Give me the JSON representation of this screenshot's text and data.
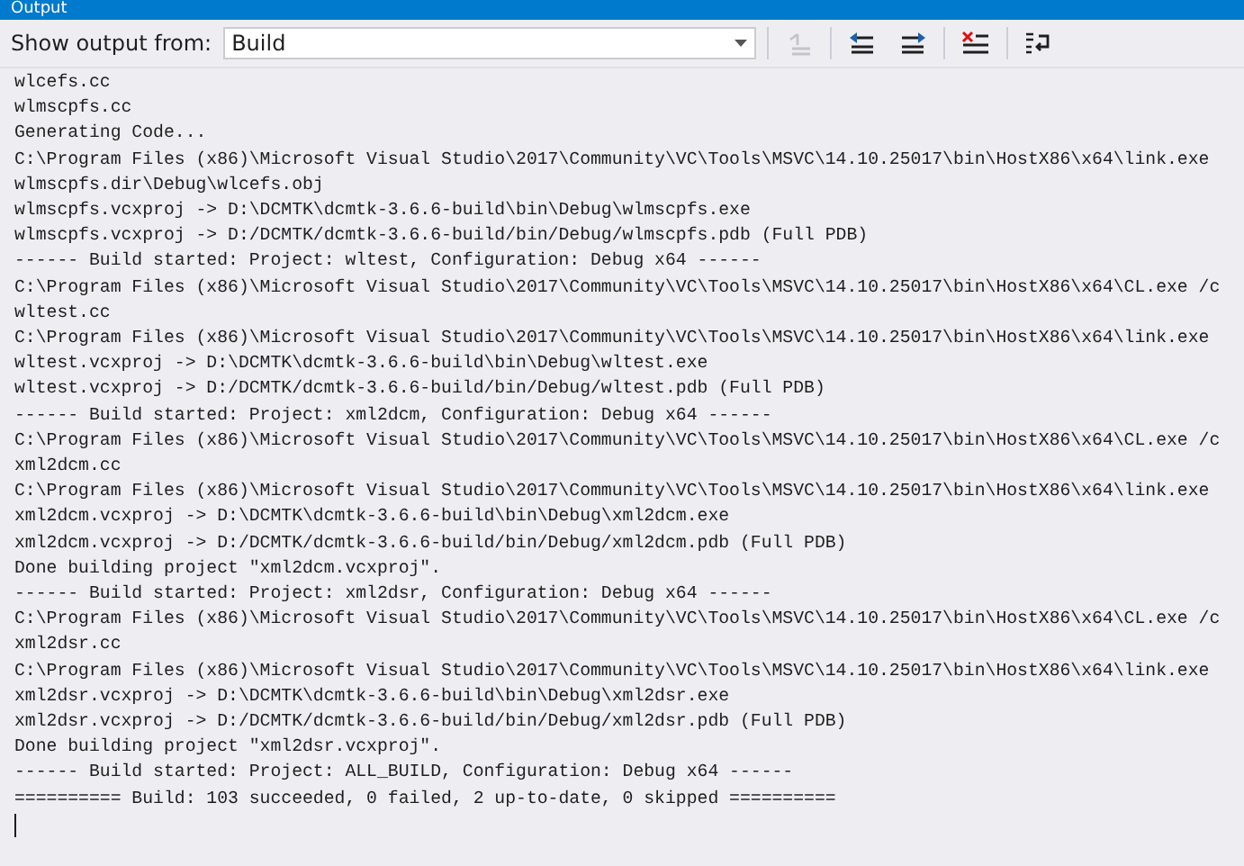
{
  "window": {
    "title": "Output"
  },
  "toolbar": {
    "label": "Show output from:",
    "source": "Build",
    "buttons": [
      {
        "kind": "goto",
        "disabled": true
      },
      {
        "kind": "previous",
        "disabled": false
      },
      {
        "kind": "next",
        "disabled": false
      },
      {
        "kind": "clear",
        "disabled": false
      },
      {
        "kind": "wrap",
        "disabled": false
      }
    ]
  },
  "output": {
    "lines": [
      "wlcefs.cc",
      "wlmscpfs.cc",
      "Generating Code...",
      "C:\\Program Files (x86)\\Microsoft Visual Studio\\2017\\Community\\VC\\Tools\\MSVC\\14.10.25017\\bin\\HostX86\\x64\\link.exe",
      "wlmscpfs.dir\\Debug\\wlcefs.obj",
      "wlmscpfs.vcxproj -> D:\\DCMTK\\dcmtk-3.6.6-build\\bin\\Debug\\wlmscpfs.exe",
      "wlmscpfs.vcxproj -> D:/DCMTK/dcmtk-3.6.6-build/bin/Debug/wlmscpfs.pdb (Full PDB)",
      "------ Build started: Project: wltest, Configuration: Debug x64 ------",
      "C:\\Program Files (x86)\\Microsoft Visual Studio\\2017\\Community\\VC\\Tools\\MSVC\\14.10.25017\\bin\\HostX86\\x64\\CL.exe /c",
      "wltest.cc",
      "C:\\Program Files (x86)\\Microsoft Visual Studio\\2017\\Community\\VC\\Tools\\MSVC\\14.10.25017\\bin\\HostX86\\x64\\link.exe",
      "wltest.vcxproj -> D:\\DCMTK\\dcmtk-3.6.6-build\\bin\\Debug\\wltest.exe",
      "wltest.vcxproj -> D:/DCMTK/dcmtk-3.6.6-build/bin/Debug/wltest.pdb (Full PDB)",
      "------ Build started: Project: xml2dcm, Configuration: Debug x64 ------",
      "C:\\Program Files (x86)\\Microsoft Visual Studio\\2017\\Community\\VC\\Tools\\MSVC\\14.10.25017\\bin\\HostX86\\x64\\CL.exe /c",
      "xml2dcm.cc",
      "C:\\Program Files (x86)\\Microsoft Visual Studio\\2017\\Community\\VC\\Tools\\MSVC\\14.10.25017\\bin\\HostX86\\x64\\link.exe",
      "xml2dcm.vcxproj -> D:\\DCMTK\\dcmtk-3.6.6-build\\bin\\Debug\\xml2dcm.exe",
      "xml2dcm.vcxproj -> D:/DCMTK/dcmtk-3.6.6-build/bin/Debug/xml2dcm.pdb (Full PDB)",
      "Done building project \"xml2dcm.vcxproj\".",
      "------ Build started: Project: xml2dsr, Configuration: Debug x64 ------",
      "C:\\Program Files (x86)\\Microsoft Visual Studio\\2017\\Community\\VC\\Tools\\MSVC\\14.10.25017\\bin\\HostX86\\x64\\CL.exe /c",
      "xml2dsr.cc",
      "C:\\Program Files (x86)\\Microsoft Visual Studio\\2017\\Community\\VC\\Tools\\MSVC\\14.10.25017\\bin\\HostX86\\x64\\link.exe",
      "xml2dsr.vcxproj -> D:\\DCMTK\\dcmtk-3.6.6-build\\bin\\Debug\\xml2dsr.exe",
      "xml2dsr.vcxproj -> D:/DCMTK/dcmtk-3.6.6-build/bin/Debug/xml2dsr.pdb (Full PDB)",
      "Done building project \"xml2dsr.vcxproj\".",
      "------ Build started: Project: ALL_BUILD, Configuration: Debug x64 ------",
      "========== Build: 103 succeeded, 0 failed, 2 up-to-date, 0 skipped =========="
    ]
  }
}
